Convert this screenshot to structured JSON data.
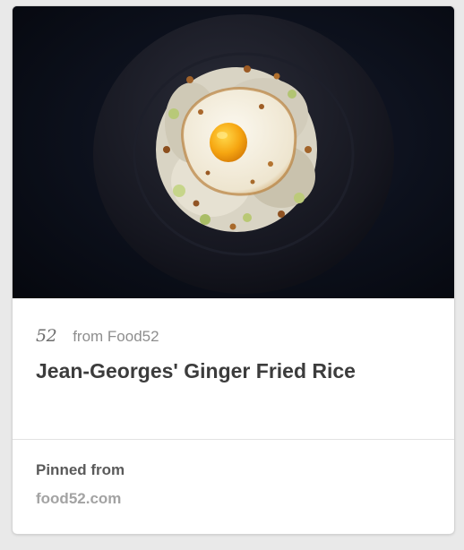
{
  "pin": {
    "source_logo": "52",
    "source_text": "from Food52",
    "title": "Jean-Georges' Ginger Fried Rice",
    "pinned_label": "Pinned from",
    "pinned_domain": "food52.com"
  },
  "colors": {
    "photo_background": "#090d17",
    "title": "#3c3c3c",
    "muted": "#8e8e8e"
  },
  "icons": {
    "source_logo": "food52-logo"
  }
}
